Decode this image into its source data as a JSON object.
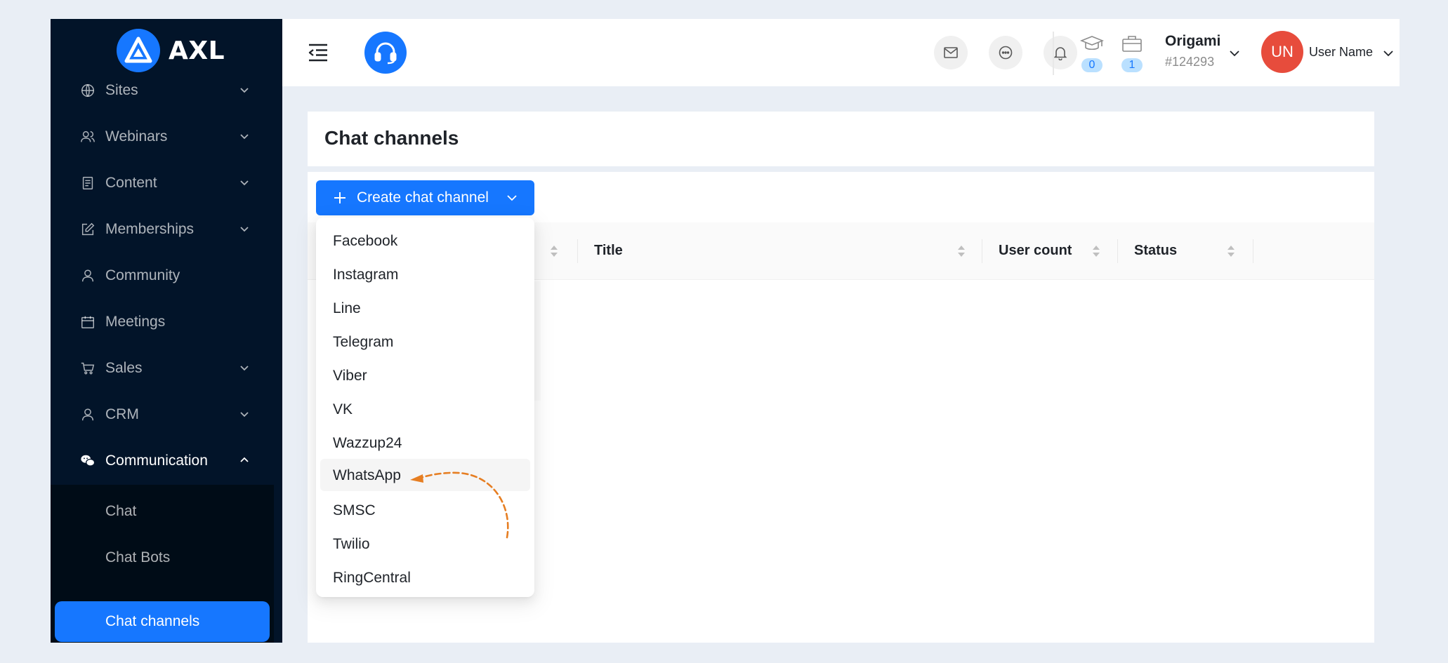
{
  "brand": {
    "name": "AXL"
  },
  "sidebar": {
    "items": [
      {
        "label": "Sites",
        "icon": "globe-icon",
        "has_children": true
      },
      {
        "label": "Webinars",
        "icon": "users-icon",
        "has_children": true
      },
      {
        "label": "Content",
        "icon": "file-icon",
        "has_children": true
      },
      {
        "label": "Memberships",
        "icon": "edit-icon",
        "has_children": true
      },
      {
        "label": "Community",
        "icon": "user-icon",
        "has_children": false
      },
      {
        "label": "Meetings",
        "icon": "calendar-icon",
        "has_children": false
      },
      {
        "label": "Sales",
        "icon": "cart-icon",
        "has_children": true
      },
      {
        "label": "CRM",
        "icon": "user-icon",
        "has_children": true
      },
      {
        "label": "Communication",
        "icon": "wechat-icon",
        "has_children": true,
        "expanded": true
      }
    ],
    "submenu": [
      {
        "label": "Chat"
      },
      {
        "label": "Chat Bots"
      },
      {
        "label": "Chat channels",
        "active": true
      }
    ]
  },
  "header": {
    "stats": [
      {
        "icon": "graduation-cap-icon",
        "count": "0"
      },
      {
        "icon": "briefcase-icon",
        "count": "1"
      }
    ],
    "org": {
      "name": "Origami",
      "id": "#124293"
    },
    "user": {
      "initials": "UN",
      "name": "User Name"
    }
  },
  "page": {
    "title": "Chat channels"
  },
  "toolbar": {
    "create_label": "Create chat channel"
  },
  "table": {
    "columns": [
      {
        "label": ""
      },
      {
        "label": "Title"
      },
      {
        "label": "User count"
      },
      {
        "label": "Status"
      }
    ]
  },
  "dropdown": {
    "options": [
      "Facebook",
      "Instagram",
      "Line",
      "Telegram",
      "Viber",
      "VK",
      "Wazzup24",
      "WhatsApp",
      "SMSC",
      "Twilio",
      "RingCentral"
    ],
    "highlighted": "WhatsApp"
  },
  "colors": {
    "primary": "#1677ff",
    "sidebar_bg": "#021429",
    "avatar_bg": "#e74c3c",
    "annotation_arrow": "#e67e22"
  }
}
